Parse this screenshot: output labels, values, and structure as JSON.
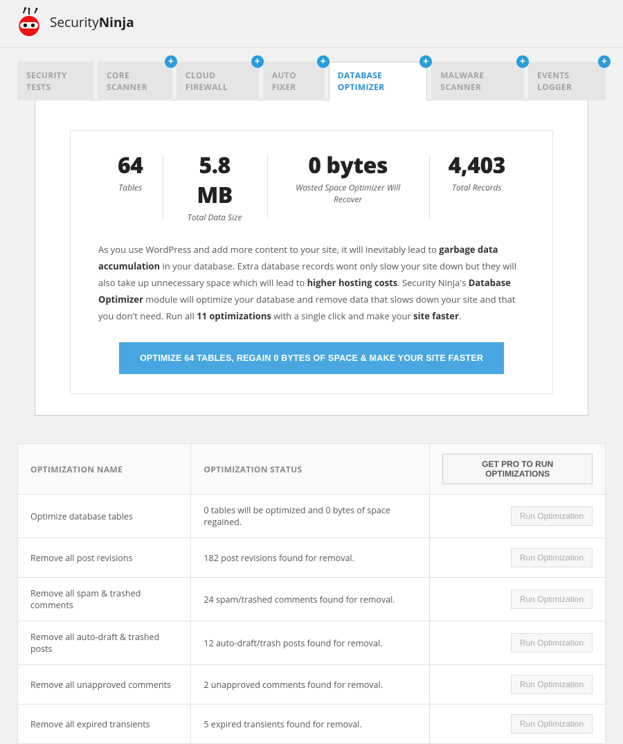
{
  "brand": {
    "first": "Security",
    "second": "Ninja"
  },
  "tabs": [
    {
      "label": "SECURITY TESTS",
      "badge": false
    },
    {
      "label": "CORE SCANNER",
      "badge": true
    },
    {
      "label": "CLOUD FIREWALL",
      "badge": true
    },
    {
      "label": "AUTO FIXER",
      "badge": true
    },
    {
      "label": "DATABASE OPTIMIZER",
      "badge": true,
      "active": true
    },
    {
      "label": "MALWARE SCANNER",
      "badge": true
    },
    {
      "label": "EVENTS LOGGER",
      "badge": true
    }
  ],
  "stats": [
    {
      "value": "64",
      "label": "Tables"
    },
    {
      "value": "5.8 MB",
      "label": "Total Data Size"
    },
    {
      "value": "0 bytes",
      "label": "Wasted Space Optimizer Will Recover"
    },
    {
      "value": "4,403",
      "label": "Total Records"
    }
  ],
  "intro": {
    "p1a": "As you use WordPress and add more content to your site, it will inevitably lead to ",
    "p1b": "garbage data accumulation",
    "p1c": " in your database. Extra database records wont only slow your site down but they will also take up unnecessary space which will lead to ",
    "p1d": "higher hosting costs",
    "p1e": ". Security Ninja's ",
    "p1f": "Database Optimizer",
    "p1g": " module will optimize your database and remove data that slows down your site and that you don't need. Run all ",
    "p1h": "11 optimizations",
    "p1i": " with a single click and make your ",
    "p1j": "site faster",
    "p1k": "."
  },
  "cta": "OPTIMIZE 64 TABLES, REGAIN 0 BYTES OF SPACE & MAKE YOUR SITE FASTER",
  "table": {
    "headers": {
      "name": "OPTIMIZATION NAME",
      "status": "OPTIMIZATION STATUS",
      "action": "GET PRO TO RUN OPTIMIZATIONS"
    },
    "run_label": "Run Optimization",
    "rows": [
      {
        "name": "Optimize database tables",
        "status": "0 tables will be optimized and 0 bytes of space regained."
      },
      {
        "name": "Remove all post revisions",
        "status": "182 post revisions found for removal."
      },
      {
        "name": "Remove all spam & trashed comments",
        "status": "24 spam/trashed comments found for removal."
      },
      {
        "name": "Remove all auto-draft & trashed posts",
        "status": "12 auto-draft/trash posts found for removal."
      },
      {
        "name": "Remove all unapproved comments",
        "status": "2 unapproved comments found for removal."
      },
      {
        "name": "Remove all expired transients",
        "status": "5 expired transients found for removal."
      }
    ]
  }
}
